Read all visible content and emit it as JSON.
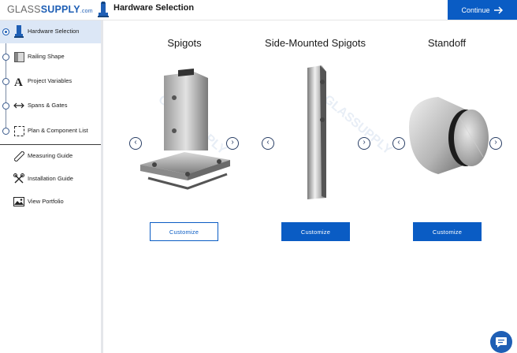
{
  "header": {
    "logo_glass": "GLASS",
    "logo_supply": "SUPPLY",
    "logo_com": ".com",
    "page_title": "Hardware Selection",
    "continue_label": "Continue",
    "continue_icon": "arrow-right-icon"
  },
  "sidebar": {
    "steps": [
      {
        "label": "Hardware Selection",
        "icon": "spigot-icon",
        "active": true
      },
      {
        "label": "Railing Shape",
        "icon": "square-shape-icon",
        "active": false
      },
      {
        "label": "Project Variables",
        "icon": "letter-a-icon",
        "active": false
      },
      {
        "label": "Spans & Gates",
        "icon": "double-arrow-icon",
        "active": false
      },
      {
        "label": "Plan & Component List",
        "icon": "dashed-square-icon",
        "active": false
      }
    ],
    "links": [
      {
        "label": "Measuring Guide",
        "icon": "ruler-icon"
      },
      {
        "label": "Installation Guide",
        "icon": "tools-icon"
      },
      {
        "label": "View Portfolio",
        "icon": "image-icon"
      }
    ]
  },
  "products": [
    {
      "title": "Spigots",
      "button": "Customize"
    },
    {
      "title": "Side-Mounted Spigots",
      "button": "Customize"
    },
    {
      "title": "Standoff",
      "button": "Customize"
    }
  ],
  "colors": {
    "accent": "#0a5cc4",
    "active_bg": "#dce7f6"
  }
}
